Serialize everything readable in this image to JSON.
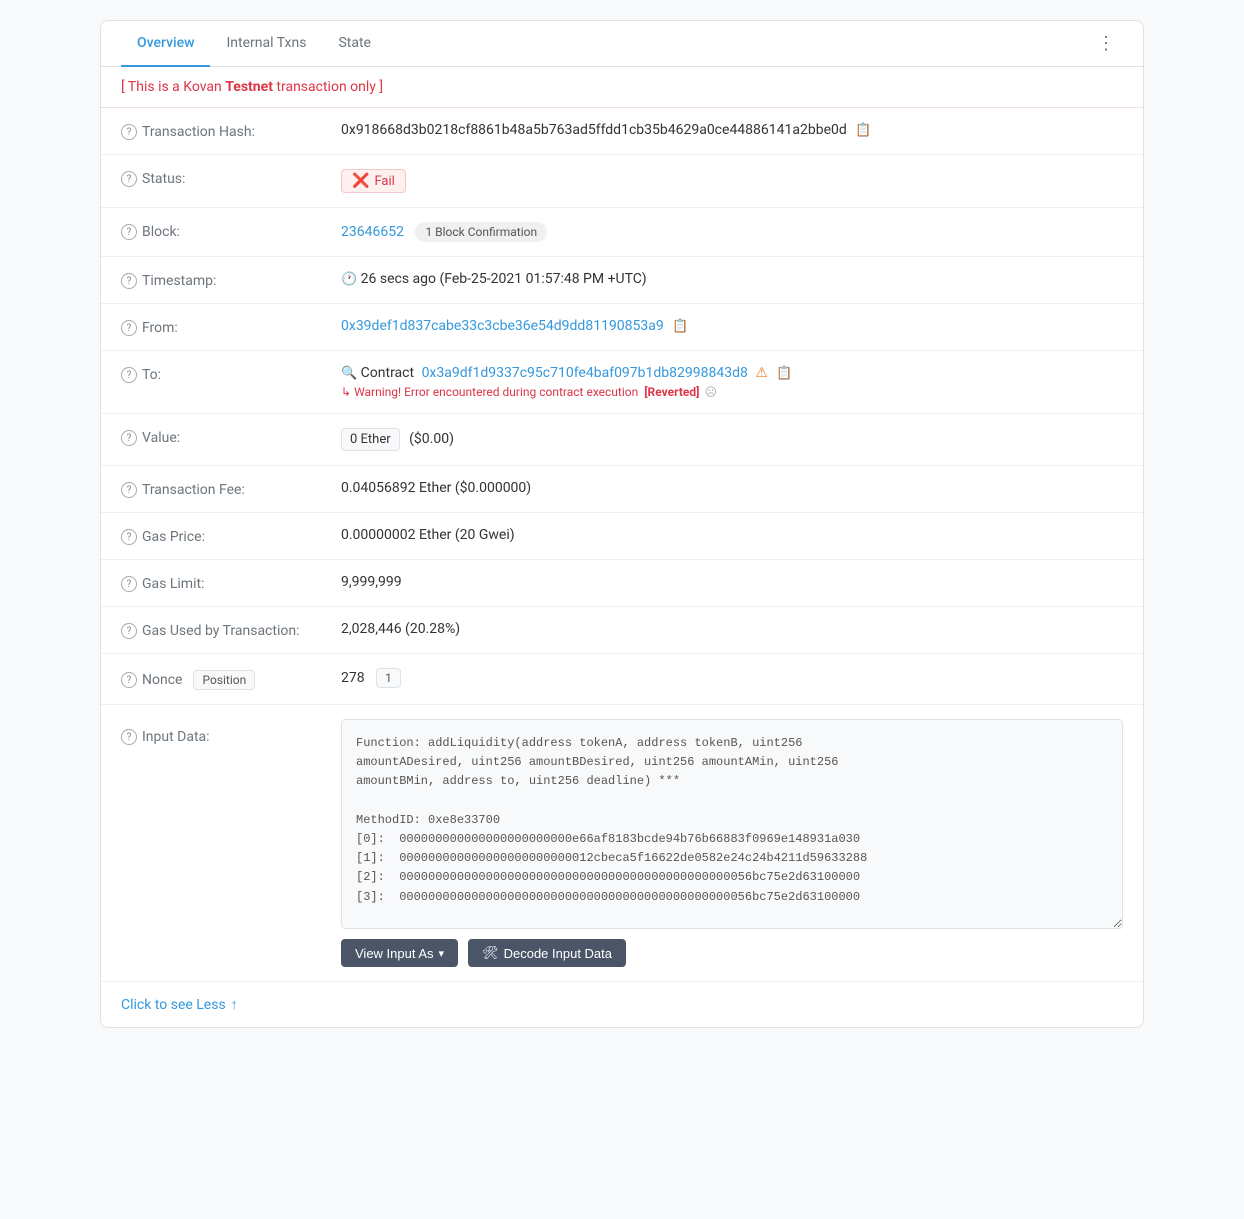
{
  "tabs": {
    "items": [
      {
        "label": "Overview",
        "active": true
      },
      {
        "label": "Internal Txns",
        "active": false
      },
      {
        "label": "State",
        "active": false
      }
    ]
  },
  "testnet_banner": {
    "prefix": "[ This is a Kovan ",
    "bold": "Testnet",
    "suffix": " transaction only ]"
  },
  "transaction": {
    "hash": {
      "label": "Transaction Hash:",
      "value": "0x918668d3b0218cf8861b48a5b763ad5ffdd1cb35b4629a0ce44886141a2bbe0d"
    },
    "status": {
      "label": "Status:",
      "value": "Fail"
    },
    "block": {
      "label": "Block:",
      "number": "23646652",
      "confirmation": "1 Block Confirmation"
    },
    "timestamp": {
      "label": "Timestamp:",
      "value": "26 secs ago (Feb-25-2021 01:57:48 PM +UTC)"
    },
    "from": {
      "label": "From:",
      "value": "0x39def1d837cabe33c3cbe36e54d9dd81190853a9"
    },
    "to": {
      "label": "To:",
      "contract_label": "Contract",
      "contract_address": "0x3a9df1d9337c95c710fe4baf097b1db82998843d8",
      "warning": "Warning! Error encountered during contract execution",
      "reverted": "[Reverted]"
    },
    "value": {
      "label": "Value:",
      "badge": "0 Ether",
      "usd": "($0.00)"
    },
    "transaction_fee": {
      "label": "Transaction Fee:",
      "value": "0.04056892 Ether ($0.000000)"
    },
    "gas_price": {
      "label": "Gas Price:",
      "value": "0.00000002 Ether (20 Gwei)"
    },
    "gas_limit": {
      "label": "Gas Limit:",
      "value": "9,999,999"
    },
    "gas_used": {
      "label": "Gas Used by Transaction:",
      "value": "2,028,446 (20.28%)"
    },
    "nonce": {
      "label": "Nonce",
      "position_label": "Position",
      "nonce_value": "278",
      "position_value": "1"
    },
    "input_data": {
      "label": "Input Data:",
      "content": "Function: addLiquidity(address tokenA, address tokenB, uint256\namountADesired, uint256 amountBDesired, uint256 amountAMin, uint256\namountBMin, address to, uint256 deadline) ***\n\nMethodID: 0xe8e33700\n[0]:  000000000000000000000000e66af8183bcde94b76b66883f0969e148931a030\n[1]:  000000000000000000000000012cbeca5f16622de0582e24c24b4211d59633288\n[2]:  0000000000000000000000000000000000000000000000056bc75e2d63100000\n[3]:  0000000000000000000000000000000000000000000000056bc75e2d63100000"
    }
  },
  "actions": {
    "view_input_as": "View Input As",
    "decode_input_data": "Decode Input Data"
  },
  "footer": {
    "see_less": "Click to see Less"
  }
}
